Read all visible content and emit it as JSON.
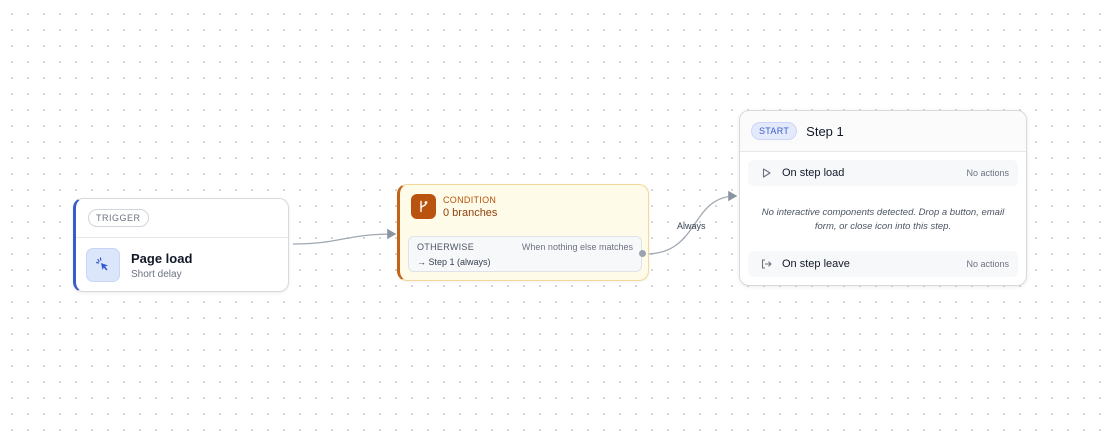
{
  "trigger": {
    "badge": "TRIGGER",
    "title": "Page load",
    "subtitle": "Short delay",
    "icon": "cursor-click-icon"
  },
  "condition": {
    "kicker": "CONDITION",
    "title": "0 branches",
    "icon": "branch-icon",
    "otherwise": {
      "label": "OTHERWISE",
      "when": "When nothing else matches",
      "target": "→ Step 1 (always)"
    }
  },
  "edges": {
    "always_label": "Always"
  },
  "step": {
    "badge": "START",
    "title": "Step 1",
    "on_load": {
      "label": "On step load",
      "status": "No actions",
      "icon": "play-icon"
    },
    "empty_note": "No interactive components detected. Drop a button, email form, or close icon into this step.",
    "on_leave": {
      "label": "On step leave",
      "status": "No actions",
      "icon": "exit-icon"
    }
  },
  "colors": {
    "trigger_accent": "#3b5bcc",
    "condition_accent": "#c2631a",
    "condition_bg": "#fffbe9",
    "start_badge": "#3b5bcc",
    "edge": "#9aa3ae"
  }
}
